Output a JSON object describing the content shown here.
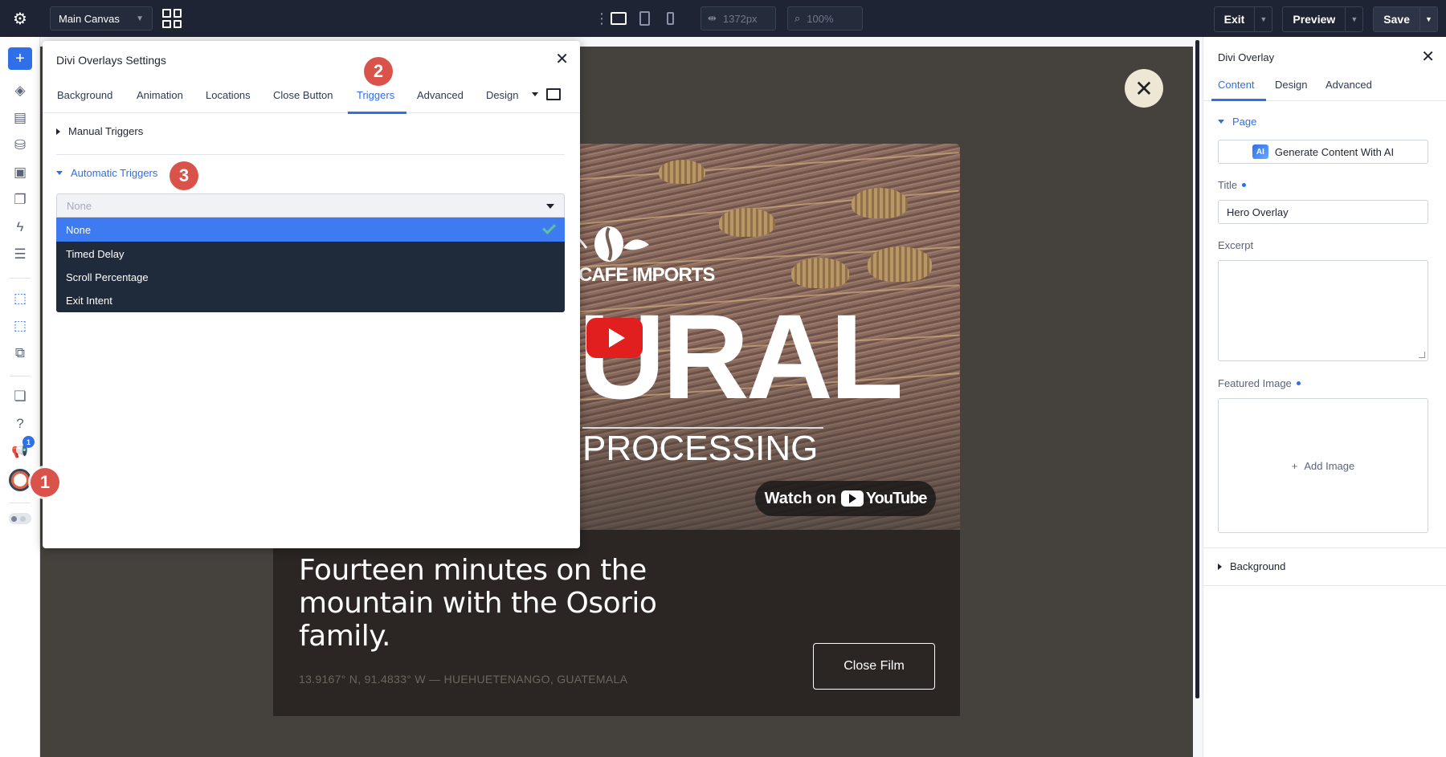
{
  "topbar": {
    "canvas_select": "Main Canvas",
    "width_value": "1372px",
    "zoom_value": "100%",
    "exit_label": "Exit",
    "preview_label": "Preview",
    "save_label": "Save",
    "icons": [
      "gear-icon",
      "grid-icon",
      "more-vertical-icon",
      "desktop-icon",
      "tablet-icon",
      "phone-icon",
      "width-icon",
      "zoom-icon"
    ]
  },
  "leftbar": {
    "icons": [
      "plus-icon",
      "layers-icon",
      "library-icon",
      "database-icon",
      "form-icon",
      "pages-icon",
      "lightning-icon",
      "sections-icon",
      "overlay-cursor-icon",
      "overlay-settings-icon",
      "template-icon",
      "window-icon",
      "help-icon",
      "megaphone-icon",
      "divi-overlay-icon",
      "toggle-icon"
    ],
    "notification_count": "1"
  },
  "steps": [
    "1",
    "2",
    "3"
  ],
  "video": {
    "brand": "CAFE IMPORTS",
    "big_word": "URAL",
    "subtitle": "PROCESSING",
    "watch_label": "Watch on",
    "youtube_label": "YouTube"
  },
  "caption": {
    "title": "Fourteen minutes on the mountain with the Osorio family.",
    "coords": "13.9167° N, 91.4833° W — HUEHUETENANGO, GUATEMALA",
    "close_film_label": "Close Film"
  },
  "modal": {
    "title": "Divi Overlays Settings",
    "tabs": [
      "Background",
      "Animation",
      "Locations",
      "Close Button",
      "Triggers",
      "Advanced",
      "Design"
    ],
    "active_tab": "Triggers",
    "manual_triggers_label": "Manual Triggers",
    "automatic_triggers_label": "Automatic Triggers",
    "select_value": "None",
    "options": [
      "None",
      "Timed Delay",
      "Scroll Percentage",
      "Exit Intent"
    ],
    "selected_option": "None"
  },
  "rpanel": {
    "title": "Divi Overlay",
    "tabs": [
      "Content",
      "Design",
      "Advanced"
    ],
    "active_tab": "Content",
    "page_section": "Page",
    "ai_button_label": "Generate Content With AI",
    "ai_badge": "AI",
    "title_label": "Title",
    "title_value": "Hero Overlay",
    "excerpt_label": "Excerpt",
    "featured_image_label": "Featured Image",
    "add_image_label": "Add Image",
    "background_section": "Background"
  },
  "colors": {
    "accent": "#2f6fe8",
    "topbar_bg": "#1e2433",
    "step_badge": "#d9534a",
    "canvas_bg": "#45423e"
  }
}
